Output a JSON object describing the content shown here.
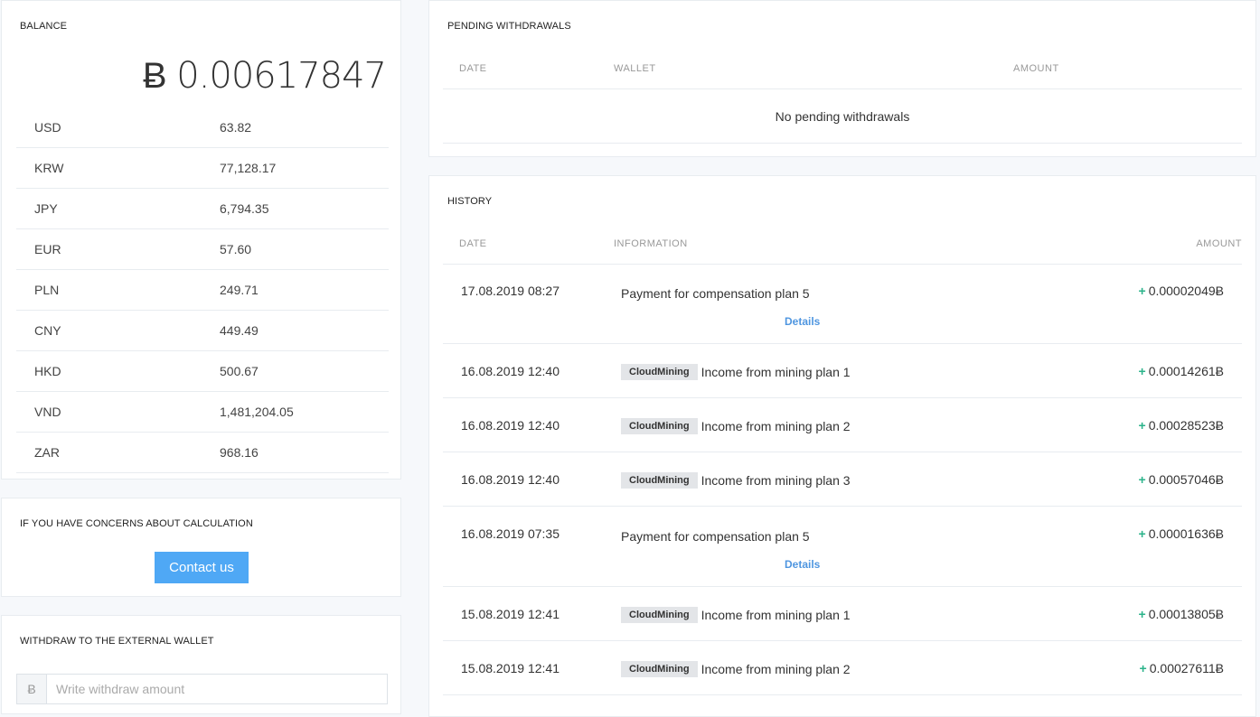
{
  "balance": {
    "title": "BALANCE",
    "amount": "Ƀ 0.00617847",
    "currencies": [
      {
        "code": "USD",
        "value": "63.82"
      },
      {
        "code": "KRW",
        "value": "77,128.17"
      },
      {
        "code": "JPY",
        "value": "6,794.35"
      },
      {
        "code": "EUR",
        "value": "57.60"
      },
      {
        "code": "PLN",
        "value": "249.71"
      },
      {
        "code": "CNY",
        "value": "449.49"
      },
      {
        "code": "HKD",
        "value": "500.67"
      },
      {
        "code": "VND",
        "value": "1,481,204.05"
      },
      {
        "code": "ZAR",
        "value": "968.16"
      }
    ]
  },
  "concerns": {
    "title": "IF YOU HAVE CONCERNS ABOUT CALCULATION",
    "button_label": "Contact us"
  },
  "withdraw": {
    "title": "WITHDRAW TO THE EXTERNAL WALLET",
    "prefix": "Ƀ",
    "placeholder": "Write withdraw amount"
  },
  "pending": {
    "title": "PENDING WITHDRAWALS",
    "columns": {
      "date": "DATE",
      "wallet": "WALLET",
      "amount": "AMOUNT"
    },
    "empty_text": "No pending withdrawals"
  },
  "history": {
    "title": "HISTORY",
    "columns": {
      "date": "DATE",
      "information": "INFORMATION",
      "amount": "AMOUNT"
    },
    "plus_symbol": "+",
    "details_label": "Details",
    "rows": [
      {
        "date": "17.08.2019 08:27",
        "tag": "",
        "info": "Payment for compensation plan 5",
        "amount": "0.00002049Ƀ",
        "has_details": true
      },
      {
        "date": "16.08.2019 12:40",
        "tag": "CloudMining",
        "info": "Income from mining plan 1",
        "amount": "0.00014261Ƀ",
        "has_details": false
      },
      {
        "date": "16.08.2019 12:40",
        "tag": "CloudMining",
        "info": "Income from mining plan 2",
        "amount": "0.00028523Ƀ",
        "has_details": false
      },
      {
        "date": "16.08.2019 12:40",
        "tag": "CloudMining",
        "info": "Income from mining plan 3",
        "amount": "0.00057046Ƀ",
        "has_details": false
      },
      {
        "date": "16.08.2019 07:35",
        "tag": "",
        "info": "Payment for compensation plan 5",
        "amount": "0.00001636Ƀ",
        "has_details": true
      },
      {
        "date": "15.08.2019 12:41",
        "tag": "CloudMining",
        "info": "Income from mining plan 1",
        "amount": "0.00013805Ƀ",
        "has_details": false
      },
      {
        "date": "15.08.2019 12:41",
        "tag": "CloudMining",
        "info": "Income from mining plan 2",
        "amount": "0.00027611Ƀ",
        "has_details": false
      }
    ]
  }
}
